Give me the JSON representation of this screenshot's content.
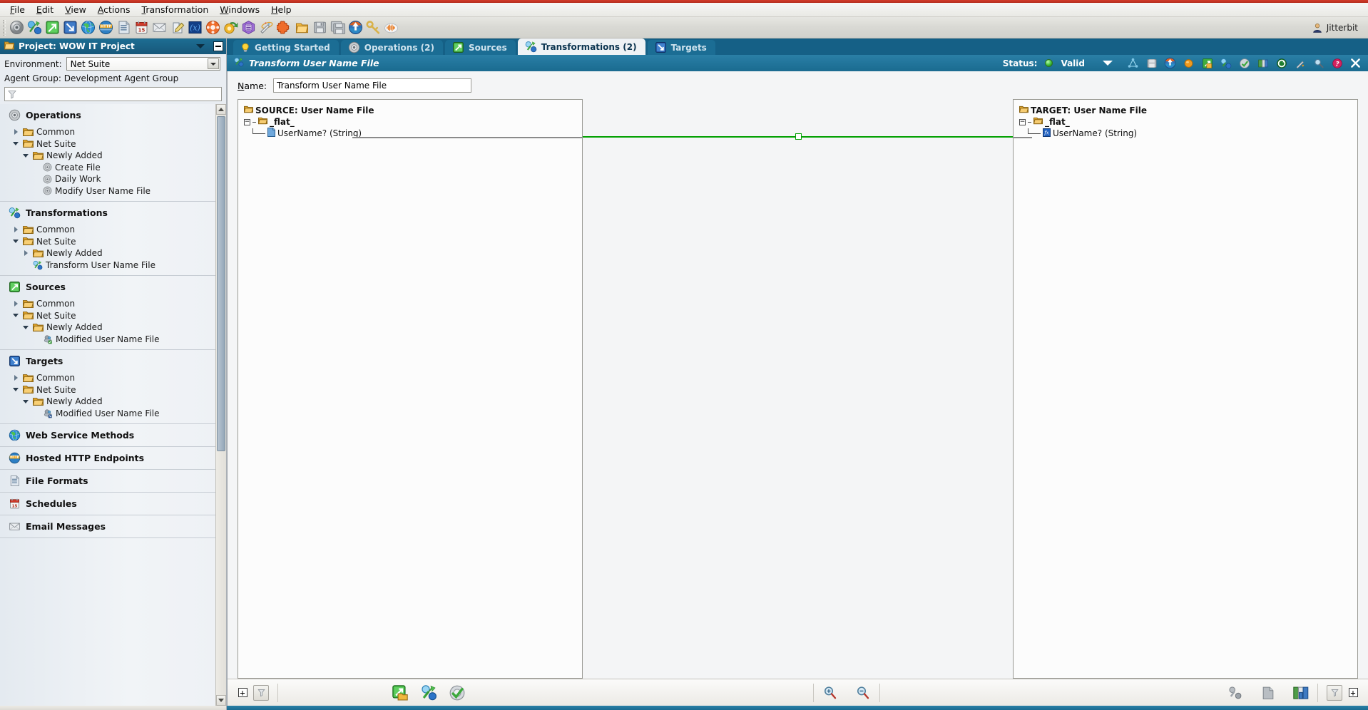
{
  "app": {
    "user": "Jitterbit",
    "accent_blue": "#17587a",
    "accent_red": "#c0392b",
    "link_green": "#00a000"
  },
  "menubar": {
    "items": [
      {
        "label": "File",
        "mnemonic": "F"
      },
      {
        "label": "Edit",
        "mnemonic": "E"
      },
      {
        "label": "View",
        "mnemonic": "V"
      },
      {
        "label": "Actions",
        "mnemonic": "A"
      },
      {
        "label": "Transformation",
        "mnemonic": "T"
      },
      {
        "label": "Windows",
        "mnemonic": "W"
      },
      {
        "label": "Help",
        "mnemonic": "H"
      }
    ]
  },
  "toolbar": {
    "buttons": [
      {
        "name": "new-operation-icon",
        "title": "Operation"
      },
      {
        "name": "new-transformation-icon",
        "title": "Transformation"
      },
      {
        "name": "new-source-icon",
        "title": "Source"
      },
      {
        "name": "new-target-icon",
        "title": "Target"
      },
      {
        "name": "web-service-methods-icon",
        "title": "Web Service Methods"
      },
      {
        "name": "hosted-http-endpoints-icon",
        "title": "Hosted HTTP Endpoints"
      },
      {
        "name": "file-formats-icon",
        "title": "File Formats"
      },
      {
        "name": "schedules-icon",
        "title": "Schedules"
      },
      {
        "name": "email-messages-icon",
        "title": "Email Messages"
      },
      {
        "name": "scripts-icon",
        "title": "Scripts"
      },
      {
        "name": "global-variables-icon",
        "title": "Global Variables"
      },
      {
        "name": "plugins-icon",
        "title": "Plugins"
      },
      {
        "name": "queues-icon",
        "title": "Queues"
      },
      {
        "name": "project-variables-icon",
        "title": "Project Variables"
      },
      {
        "name": "wizard-icon",
        "title": "Wizard"
      },
      {
        "name": "puzzle-icon",
        "title": "Connectors"
      },
      {
        "name": "open-project-icon",
        "title": "Open Project"
      },
      {
        "name": "save-icon",
        "title": "Save"
      },
      {
        "name": "save-all-icon",
        "title": "Save All"
      },
      {
        "name": "deploy-icon",
        "title": "Deploy"
      },
      {
        "name": "key-icon",
        "title": "Security"
      },
      {
        "name": "activity-icon",
        "title": "Activity"
      }
    ]
  },
  "sidebar": {
    "project_title": "Project: WOW IT Project",
    "environment_label": "Environment:",
    "environment_value": "Net Suite",
    "agent_group_text": "Agent Group: Development Agent Group",
    "filter_placeholder": "",
    "sections": [
      {
        "name": "operations",
        "icon": "operations-icon",
        "label": "Operations",
        "nodes": [
          {
            "label": "Common",
            "depth": 1,
            "twisty": "right",
            "icon": "folder-icon"
          },
          {
            "label": "Net Suite",
            "depth": 1,
            "twisty": "down",
            "icon": "folder-icon"
          },
          {
            "label": "Newly Added",
            "depth": 2,
            "twisty": "down",
            "icon": "folder-icon"
          },
          {
            "label": "Create File",
            "depth": 3,
            "twisty": "none",
            "icon": "operation-item-icon"
          },
          {
            "label": "Daily Work",
            "depth": 3,
            "twisty": "none",
            "icon": "operation-item-icon"
          },
          {
            "label": "Modify User Name File",
            "depth": 3,
            "twisty": "none",
            "icon": "operation-item-icon"
          }
        ]
      },
      {
        "name": "transformations",
        "icon": "transformations-icon",
        "label": "Transformations",
        "nodes": [
          {
            "label": "Common",
            "depth": 1,
            "twisty": "right",
            "icon": "folder-icon"
          },
          {
            "label": "Net Suite",
            "depth": 1,
            "twisty": "down",
            "icon": "folder-icon"
          },
          {
            "label": "Newly Added",
            "depth": 2,
            "twisty": "right",
            "icon": "folder-icon"
          },
          {
            "label": "Transform User Name File",
            "depth": 2,
            "twisty": "none",
            "icon": "transformation-item-icon"
          }
        ]
      },
      {
        "name": "sources",
        "icon": "sources-icon",
        "label": "Sources",
        "nodes": [
          {
            "label": "Common",
            "depth": 1,
            "twisty": "right",
            "icon": "folder-icon"
          },
          {
            "label": "Net Suite",
            "depth": 1,
            "twisty": "down",
            "icon": "folder-icon"
          },
          {
            "label": "Newly Added",
            "depth": 2,
            "twisty": "down",
            "icon": "folder-icon"
          },
          {
            "label": "Modified User Name File",
            "depth": 3,
            "twisty": "none",
            "icon": "source-item-icon"
          }
        ]
      },
      {
        "name": "targets",
        "icon": "targets-icon",
        "label": "Targets",
        "nodes": [
          {
            "label": "Common",
            "depth": 1,
            "twisty": "right",
            "icon": "folder-icon"
          },
          {
            "label": "Net Suite",
            "depth": 1,
            "twisty": "down",
            "icon": "folder-icon"
          },
          {
            "label": "Newly Added",
            "depth": 2,
            "twisty": "down",
            "icon": "folder-icon"
          },
          {
            "label": "Modified User Name File",
            "depth": 3,
            "twisty": "none",
            "icon": "target-item-icon"
          }
        ]
      },
      {
        "name": "web-service-methods",
        "icon": "globe-icon",
        "label": "Web Service Methods",
        "nodes": []
      },
      {
        "name": "hosted-http-endpoints",
        "icon": "http-icon",
        "label": "Hosted HTTP Endpoints",
        "nodes": []
      },
      {
        "name": "file-formats",
        "icon": "file-formats-icon",
        "label": "File Formats",
        "nodes": []
      },
      {
        "name": "schedules",
        "icon": "calendar-icon",
        "label": "Schedules",
        "nodes": []
      },
      {
        "name": "email-messages",
        "icon": "envelope-icon",
        "label": "Email Messages",
        "nodes": []
      }
    ]
  },
  "tabs": [
    {
      "label": "Getting Started",
      "icon": "lightbulb-icon",
      "active": false
    },
    {
      "label": "Operations (2)",
      "icon": "operations-icon",
      "active": false
    },
    {
      "label": "Sources",
      "icon": "sources-icon",
      "active": false
    },
    {
      "label": "Transformations (2)",
      "icon": "transformations-icon",
      "active": true
    },
    {
      "label": "Targets",
      "icon": "targets-icon",
      "active": false
    }
  ],
  "editor": {
    "title": "Transform User Name File",
    "title_icon": "transformations-icon",
    "status_label": "Status:",
    "status_value": "Valid",
    "name_label": "Name:",
    "name_value": "Transform User Name File",
    "titlebar_buttons": [
      {
        "name": "graph-view-icon",
        "title": "Graph View"
      },
      {
        "name": "save-icon",
        "title": "Save"
      },
      {
        "name": "deploy-icon",
        "title": "Deploy"
      },
      {
        "name": "orange-sphere-icon",
        "title": "Test"
      },
      {
        "name": "source-icon",
        "title": "Source"
      },
      {
        "name": "transformation-icon",
        "title": "Transformation"
      },
      {
        "name": "undo-icon",
        "title": "Undo"
      },
      {
        "name": "file-format-icon",
        "title": "File Format"
      },
      {
        "name": "refresh-icon",
        "title": "Refresh"
      },
      {
        "name": "wand-icon",
        "title": "Auto Map"
      },
      {
        "name": "search-icon",
        "title": "Find"
      },
      {
        "name": "help-icon",
        "title": "Help"
      },
      {
        "name": "close-icon",
        "title": "Close"
      }
    ],
    "source": {
      "root_label": "SOURCE: User Name File",
      "group_label": "_flat_",
      "field_label": "UserName? (String)"
    },
    "target": {
      "root_label": "TARGET: User Name File",
      "group_label": "_flat_",
      "field_label": "UserName? (String)"
    },
    "mapping": {
      "from": "UserName? (String)",
      "to": "UserName? (String)",
      "color": "#00a000"
    }
  },
  "bottombar": {
    "left_buttons": [
      {
        "name": "expand-all-button",
        "icon": "plus-box-icon"
      },
      {
        "name": "filter-button",
        "icon": "funnel-icon"
      }
    ],
    "source_tools": [
      {
        "name": "change-source-button",
        "icon": "source-folder-icon"
      },
      {
        "name": "source-transformation-button",
        "icon": "transformation-green-icon"
      },
      {
        "name": "validate-source-button",
        "icon": "validate-icon"
      }
    ],
    "zoom_tools": [
      {
        "name": "zoom-in-button",
        "icon": "zoom-in-icon"
      },
      {
        "name": "zoom-out-button",
        "icon": "zoom-out-icon"
      }
    ],
    "target_tools": [
      {
        "name": "target-mapping-button",
        "icon": "mapping-icon"
      },
      {
        "name": "target-file-button",
        "icon": "file-icon"
      },
      {
        "name": "target-structure-button",
        "icon": "structure-icon"
      }
    ],
    "right_buttons": [
      {
        "name": "target-filter-button",
        "icon": "funnel-icon"
      },
      {
        "name": "target-expand-button",
        "icon": "plus-box-icon"
      }
    ]
  }
}
